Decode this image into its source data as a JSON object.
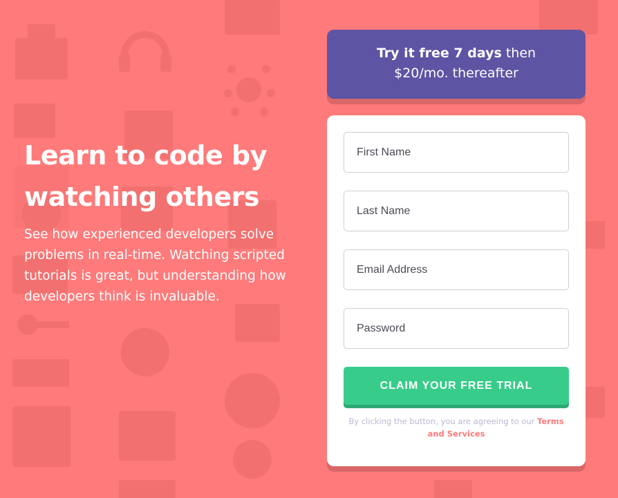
{
  "colors": {
    "background": "#ff7a7a",
    "promo_bg": "#5e54a4",
    "button": "#38cc8b",
    "terms_link": "#ff7a7a"
  },
  "hero": {
    "headline": "Learn to code by watching others",
    "intro": "See how experienced developers solve problems in real-time. Watching scripted tutorials is great, but understanding how developers think is invaluable."
  },
  "promo": {
    "bold": "Try it free 7 days",
    "rest_line1": " then",
    "line2": "$20/mo. thereafter"
  },
  "form": {
    "first_name_placeholder": "First Name",
    "last_name_placeholder": "Last Name",
    "email_placeholder": "Email Address",
    "password_placeholder": "Password",
    "submit_label": "CLAIM YOUR FREE TRIAL",
    "terms_prefix": "By clicking the button, you are agreeing to our ",
    "terms_link": "Terms and Services"
  },
  "background_icons": [
    "toolbox-icon",
    "headset-icon",
    "network-icon",
    "browser-window-icon",
    "gear-icon",
    "lifebuoy-icon",
    "calendar-icon",
    "lightbulb-icon",
    "key-icon",
    "cart-icon",
    "pencil-icon"
  ]
}
